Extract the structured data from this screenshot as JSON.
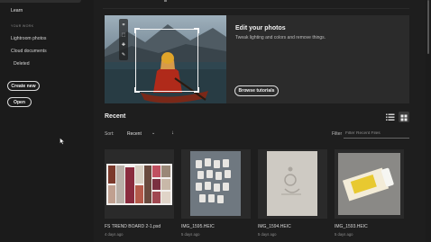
{
  "sidebar": {
    "learn": "Learn",
    "section": "YOUR WORK",
    "items": [
      "Lightroom photos",
      "Cloud documents",
      "Deleted"
    ],
    "create_new": "Create new",
    "open": "Open"
  },
  "banner": {
    "title": "Edit your photos",
    "subtitle": "Tweak lighting and colors and remove things.",
    "button": "Browse tutorials",
    "tools": [
      "crop-icon",
      "select-icon",
      "heal-icon",
      "brush-icon"
    ]
  },
  "recent": {
    "title": "Recent",
    "sort_label": "Sort:",
    "sort_value": "Recent",
    "filter_label": "Filter",
    "filter_placeholder": "Filter Recent Files",
    "files": [
      {
        "name": "FS TREND BOARD 2-1.psd",
        "date": "4 days ago"
      },
      {
        "name": "IMG_1595.HEIC",
        "date": "5 days ago"
      },
      {
        "name": "IMG_1594.HEIC",
        "date": "5 days ago"
      },
      {
        "name": "IMG_1593.HEIC",
        "date": "5 days ago"
      }
    ]
  },
  "colors": {
    "background": "#1e1e1e",
    "sidebar": "#1b1b1b",
    "banner": "#2b2b2b",
    "text": "#d8d8d8"
  }
}
